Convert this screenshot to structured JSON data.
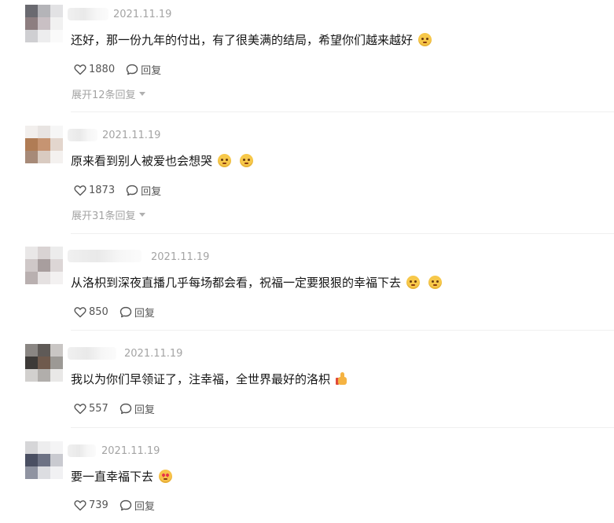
{
  "comments": [
    {
      "date": "2021.11.19",
      "text": "还好，那一份九年的付出，有了很美满的结局，希望你们越来越好",
      "emojis": [
        "pleading-face"
      ],
      "likes": "1880",
      "reply_label": "回复",
      "expand_label": "展开12条回复",
      "avatar_colors": [
        "#6a6a70",
        "#b4b4b8",
        "#e2e2e4",
        "#8d7e80",
        "#c9c0c4",
        "#f1f1f1",
        "#cfcfd2",
        "#ededee",
        "#fafafa"
      ]
    },
    {
      "date": "2021.11.19",
      "text": "原来看到别人被爱也会想哭",
      "emojis": [
        "pleading-face",
        "pleading-face"
      ],
      "likes": "1873",
      "reply_label": "回复",
      "expand_label": "展开31条回复",
      "avatar_colors": [
        "#f2efed",
        "#e8e4e2",
        "#f6f6f6",
        "#b07c55",
        "#c69472",
        "#e3d6cd",
        "#a78a78",
        "#d9cbc1",
        "#f4f1ef"
      ]
    },
    {
      "date": "2021.11.19",
      "text": "从洛枳到深夜直播几乎每场都会看，祝福一定要狠狠的幸福下去",
      "emojis": [
        "pleading-face",
        "pleading-face"
      ],
      "likes": "850",
      "reply_label": "回复",
      "avatar_colors": [
        "#e9e7e7",
        "#d9d3d3",
        "#ececec",
        "#cfc8c8",
        "#a89e9e",
        "#dcd6d6",
        "#b9b0b0",
        "#e5e1e1",
        "#f3f1f1"
      ]
    },
    {
      "date": "2021.11.19",
      "text": "我以为你们早领证了，注幸福，全世界最好的洛枳",
      "emojis": [
        "thumbs-up"
      ],
      "likes": "557",
      "reply_label": "回复",
      "avatar_colors": [
        "#8a8683",
        "#5f5a57",
        "#c9c6c4",
        "#3d3a38",
        "#6f5a4d",
        "#9c9995",
        "#d2d0ce",
        "#b1aeab",
        "#e9e8e7"
      ]
    },
    {
      "date": "2021.11.19",
      "text": "要一直幸福下去",
      "emojis": [
        "heart-eyes-face"
      ],
      "likes": "739",
      "reply_label": "回复",
      "avatar_colors": [
        "#d6d6d8",
        "#ededee",
        "#f4f4f5",
        "#4a4f62",
        "#6d7284",
        "#c9cad0",
        "#8f93a1",
        "#dcdde1",
        "#f1f1f3"
      ]
    }
  ]
}
